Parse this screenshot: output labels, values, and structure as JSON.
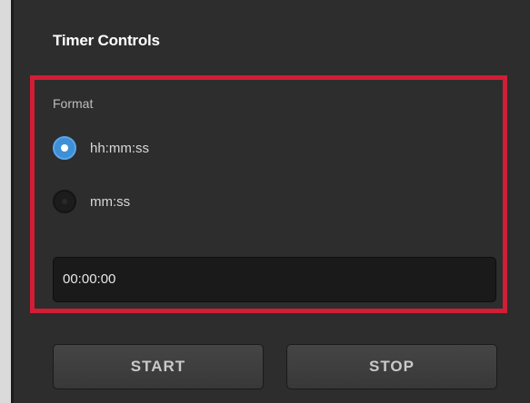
{
  "panel": {
    "title": "Timer Controls"
  },
  "format": {
    "label": "Format",
    "options": [
      {
        "label": "hh:mm:ss",
        "selected": true
      },
      {
        "label": "mm:ss",
        "selected": false
      }
    ]
  },
  "timer": {
    "value": "00:00:00"
  },
  "buttons": {
    "start_label": "START",
    "stop_label": "STOP"
  },
  "colors": {
    "panel_bg": "#2d2d2d",
    "highlight": "#d11d35",
    "radio_selected": "#3d8fd6"
  }
}
